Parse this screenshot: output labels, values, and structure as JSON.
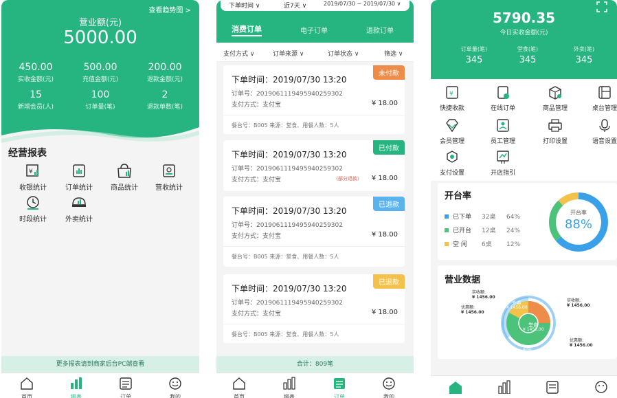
{
  "s1": {
    "trend_link": "查看趋势图 >",
    "revenue_label": "营业额(元)",
    "revenue_value": "5000.00",
    "stats": [
      {
        "value": "450.00",
        "label": "实收金额(元)"
      },
      {
        "value": "500.00",
        "label": "充值金额(元)"
      },
      {
        "value": "200.00",
        "label": "退款金额(元)"
      },
      {
        "value": "15",
        "label": "新增会员(人)"
      },
      {
        "value": "100",
        "label": "订单量(笔)"
      },
      {
        "value": "2",
        "label": "退款单数(笔)"
      }
    ],
    "section_title": "经营报表",
    "reports": [
      "收银统计",
      "订单统计",
      "商品统计",
      "营收统计",
      "时段统计",
      "外卖统计"
    ],
    "footer_note": "更多报表请到商家后台PC端查看",
    "tabs": [
      "首页",
      "报表",
      "订单",
      "我的"
    ]
  },
  "s2": {
    "filter_time": "下单时间 ∨",
    "filter_range": "近7天 ∨",
    "filter_dates": "2019/07/30 ~ 2019/07/30 ∨",
    "top_tabs": [
      "消费订单",
      "电子订单",
      "退款订单"
    ],
    "filters": [
      "支付方式 ∨",
      "订单来源 ∨",
      "订单状态 ∨",
      "筛选 ∨"
    ],
    "orders": [
      {
        "time": "下单时间：2019/07/30 13:20",
        "status": "未付款",
        "order_no": "订单号：20190611194959402593​02",
        "pay": "支付方式：支付宝",
        "refund": "",
        "price": "¥ 18.00",
        "foot": "餐台号：B005  来源：堂食、用餐人数：5人"
      },
      {
        "time": "下单时间：2019/07/30 13:20",
        "status": "已付款",
        "order_no": "订单号：20190611194959402593​02",
        "pay": "支付方式：支付宝",
        "refund": "（部分退款）",
        "price": "¥ 18.00",
        "foot": "餐台号：B005  来源：堂食、用餐人数：5人"
      },
      {
        "time": "下单时间：2019/07/30 13:20",
        "status": "已退款",
        "order_no": "订单号：20190611194959402593​02",
        "pay": "支付方式：支付宝",
        "refund": "",
        "price": "¥ 18.00",
        "foot": "餐台号：B005  来源：堂食、用餐人数：5人"
      },
      {
        "time": "下单时间：2019/07/30 13:20",
        "status": "已退款",
        "order_no": "订单号：20190611194959402593​02",
        "pay": "支付方式：支付宝",
        "refund": "",
        "price": "¥ 18.00",
        "foot": "餐台号：B005  来源：堂食、用餐人数：5人"
      }
    ],
    "total": "合计：809笔",
    "tabs": [
      "首页",
      "报表",
      "订单",
      "我的"
    ]
  },
  "s3": {
    "income_value": "5790.35",
    "income_label": "今日实收金额(元)",
    "stats": [
      {
        "label": "订单量(笔)",
        "value": "345"
      },
      {
        "label": "堂食(笔)",
        "value": "345"
      },
      {
        "label": "外卖(笔)",
        "value": "345"
      }
    ],
    "menu": [
      "快捷收款",
      "在线订单",
      "商品管理",
      "桌台管理",
      "会员管理",
      "员工管理",
      "打印设置",
      "语音设置",
      "支付设置",
      "开店指引"
    ],
    "table_rate_title": "开台率",
    "table_rate_legend": [
      {
        "name": "已下单",
        "count": "32桌",
        "pct": "64%",
        "color": "#3aa0e8"
      },
      {
        "name": "已开台",
        "count": "12桌",
        "pct": "24%",
        "color": "#4cc27a"
      },
      {
        "name": "空  闲",
        "count": "6桌",
        "pct": "12%",
        "color": "#f4c14b"
      }
    ],
    "donut_label": "开台率",
    "donut_value": "88%",
    "biz_title": "营业数据",
    "pie_labels": [
      {
        "text": "实收额:",
        "value": "¥ 1456.00"
      },
      {
        "text": "优惠额:",
        "value": "¥ 1456.00"
      },
      {
        "text": "实收额:",
        "value": "¥ 1456.00"
      },
      {
        "text": "优惠额:",
        "value": "¥ 1456.00"
      }
    ],
    "pie_inner": [
      {
        "text": "外卖",
        "value": "¥ 1456.00"
      },
      {
        "text": "堂食",
        "value": "¥ 1456.00"
      }
    ],
    "pie_pct": [
      "40%",
      "60%"
    ],
    "colors": {
      "primary": "#26b481",
      "orange": "#f08c4a",
      "blue": "#3aa0e8",
      "yellow": "#f4c14b"
    }
  },
  "chart_data": {
    "type": "pie",
    "title": "开台率",
    "categories": [
      "已下单",
      "已开台",
      "空闲"
    ],
    "values": [
      64,
      24,
      12
    ]
  }
}
